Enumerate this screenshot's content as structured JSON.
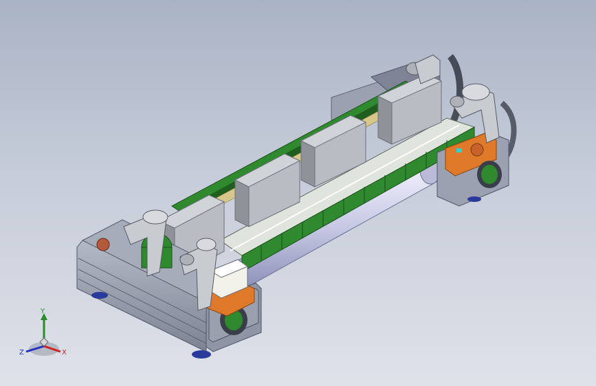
{
  "viewport": {
    "background_top": "#aab3c5",
    "background_bottom": "#dfe2e9"
  },
  "colors": {
    "frame": "#9aa0ae",
    "frame_dark": "#6f7585",
    "conveyor_green": "#2f8a2f",
    "conveyor_dark": "#1f5e1f",
    "box": "#b9bcc2",
    "box_side": "#8f9399",
    "clamp": "#c8cbcf",
    "orange": "#e07a2b",
    "roller": "#dfe0f2",
    "motor_white": "#f2f2ea"
  },
  "triad": {
    "y_label": "Y",
    "z_label": "Z",
    "x_label": "X",
    "y_color": "#2a8a2a",
    "z_color": "#2430c8",
    "x_color": "#d02020"
  }
}
